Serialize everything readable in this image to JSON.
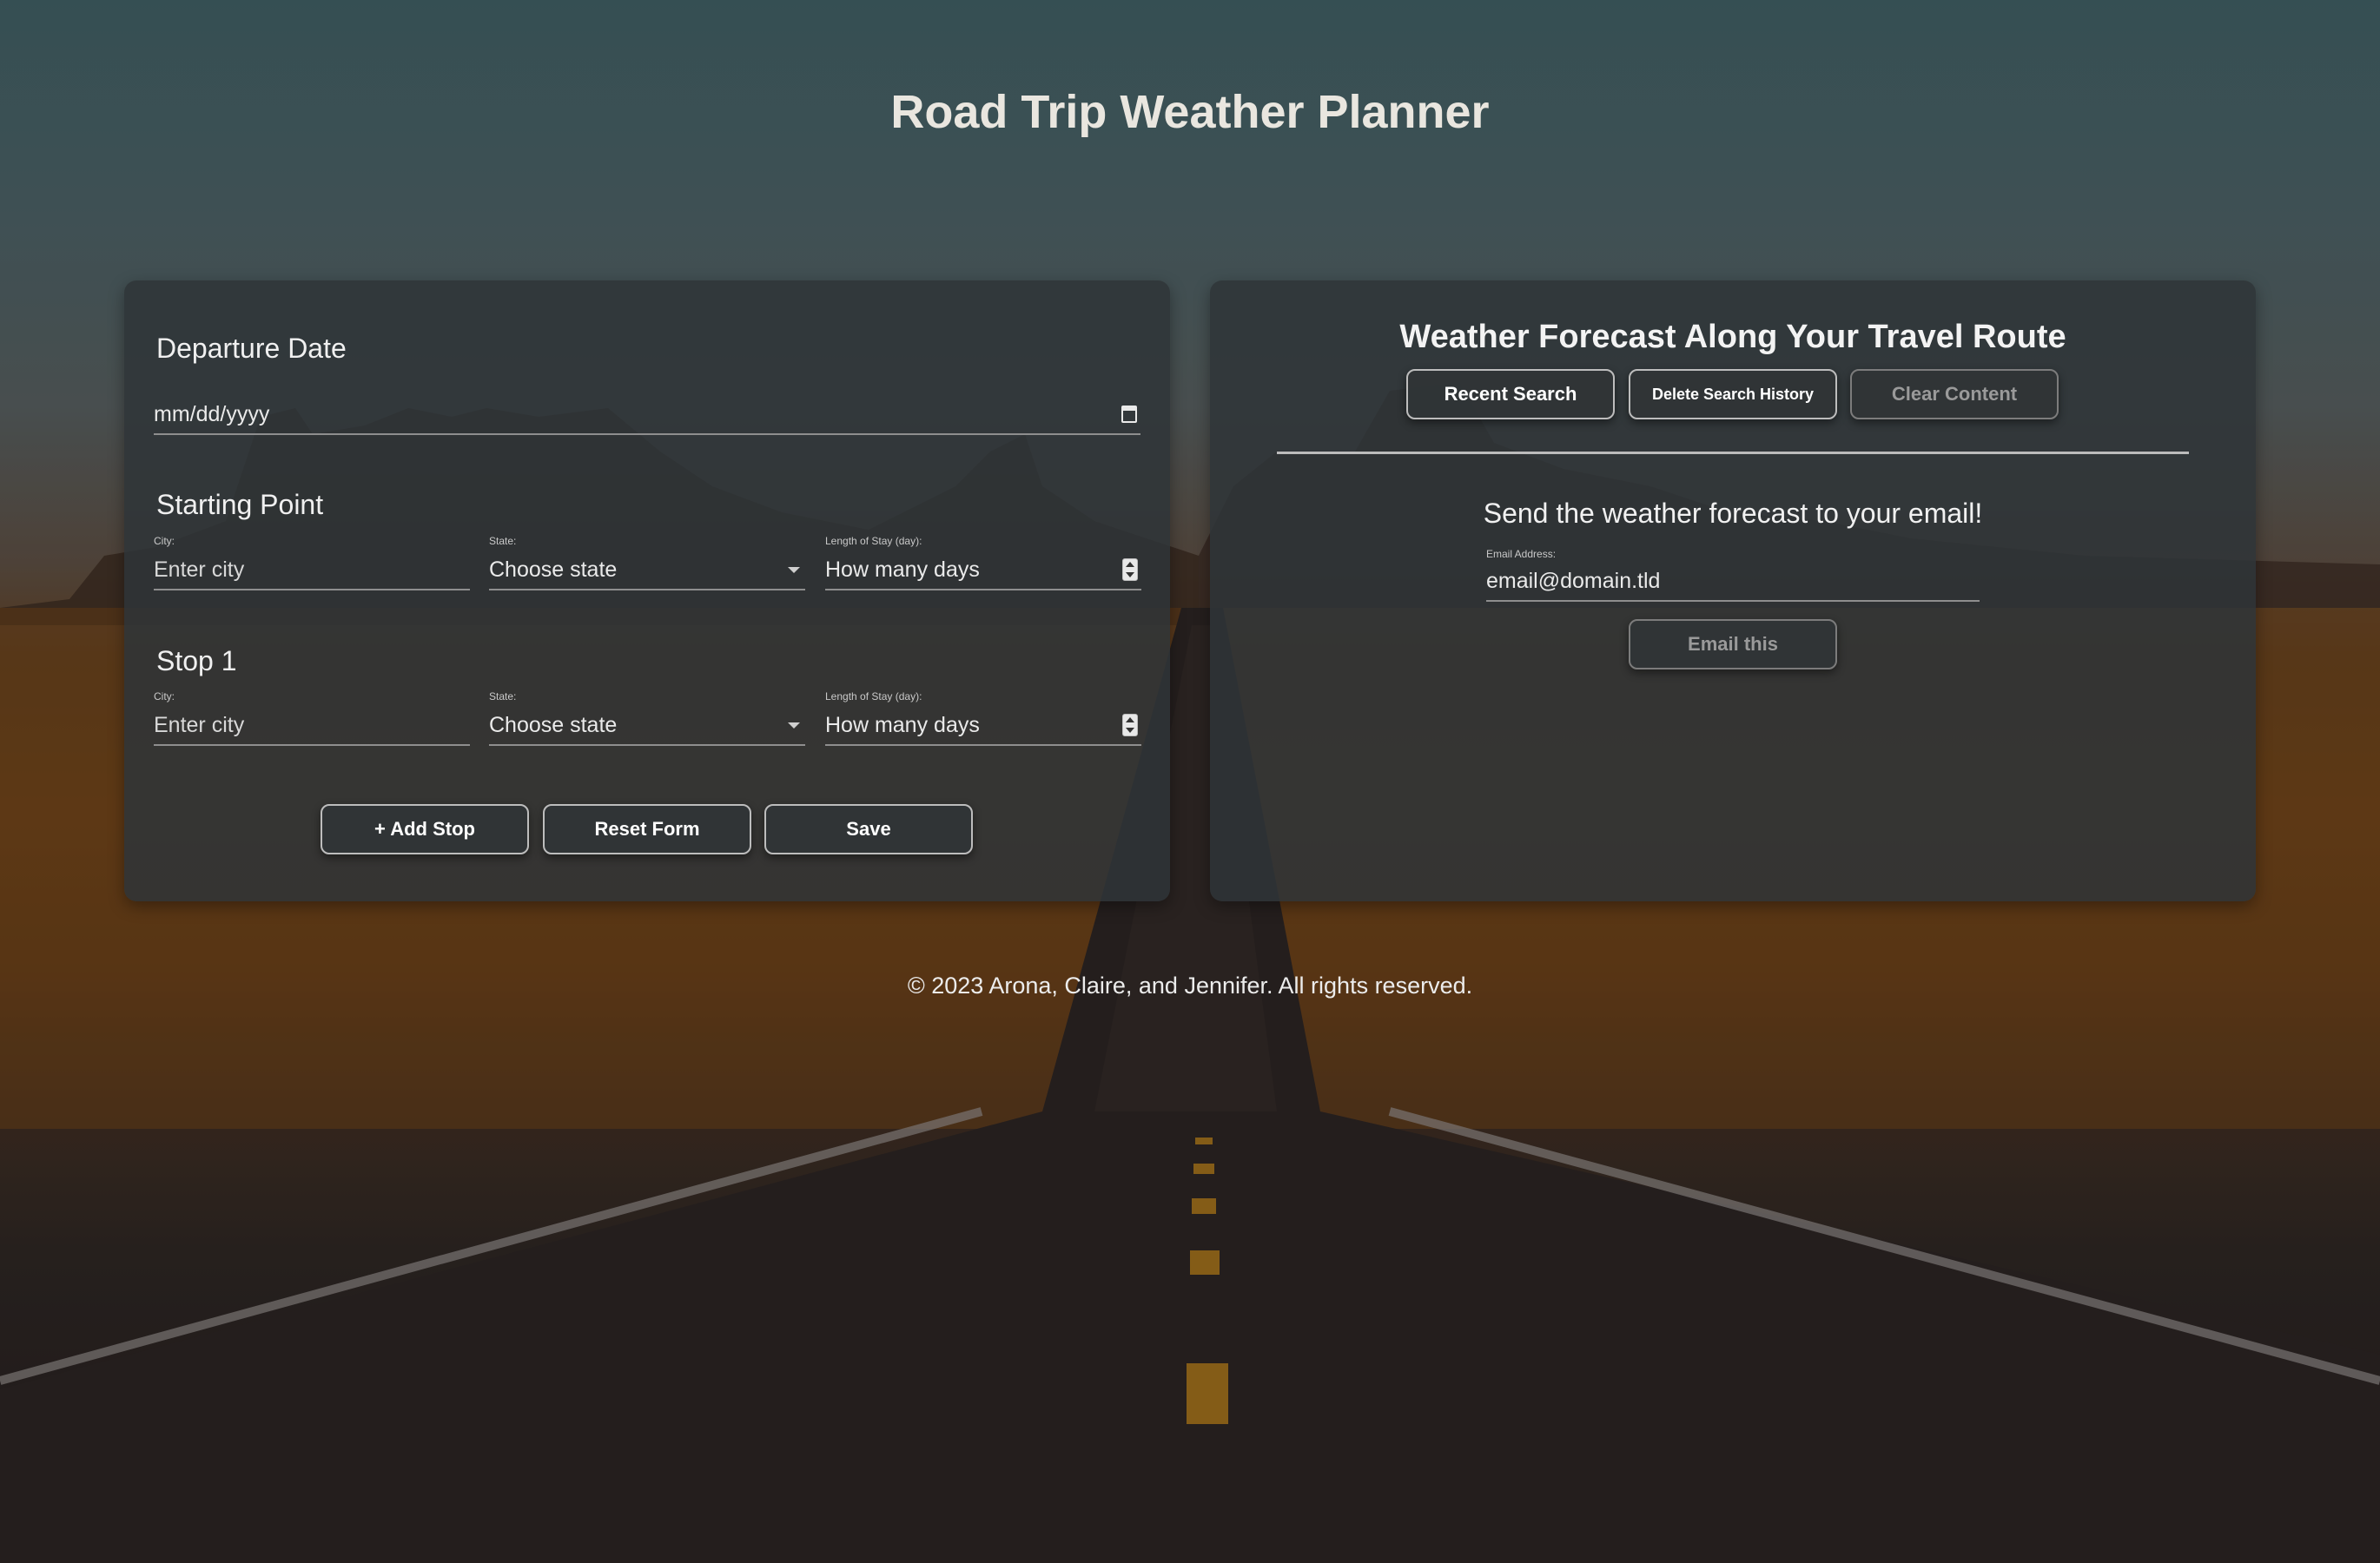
{
  "page": {
    "title": "Road Trip Weather Planner",
    "footer": "© 2023 Arona, Claire, and Jennifer. All rights reserved."
  },
  "planner": {
    "departure": {
      "label": "Departure Date",
      "placeholder": "mm/dd/yyyy"
    },
    "starting_point": {
      "label": "Starting Point",
      "city_label": "City:",
      "city_placeholder": "Enter city",
      "state_label": "State:",
      "state_value": "Choose state",
      "stay_label": "Length of Stay (day):",
      "stay_placeholder": "How many days"
    },
    "stop_1": {
      "label": "Stop 1",
      "city_label": "City:",
      "city_placeholder": "Enter city",
      "state_label": "State:",
      "state_value": "Choose state",
      "stay_label": "Length of Stay (day):",
      "stay_placeholder": "How many days"
    },
    "buttons": {
      "add_stop": "+ Add Stop",
      "reset": "Reset Form",
      "save": "Save"
    }
  },
  "forecast": {
    "title": "Weather Forecast Along Your Travel Route",
    "buttons": {
      "recent": "Recent Search",
      "delete_history": "Delete Search History",
      "clear": "Clear Content"
    },
    "email": {
      "heading": "Send the weather forecast to your email!",
      "label": "Email Address:",
      "placeholder": "email@domain.tld",
      "send": "Email this"
    }
  },
  "icons": {
    "date": "calendar-icon",
    "select": "chevron-down-icon",
    "number": "spinner-icon"
  },
  "colors": {
    "panel": "#2e3438",
    "button_border": "#bdbdbd",
    "text": "#ececec"
  }
}
